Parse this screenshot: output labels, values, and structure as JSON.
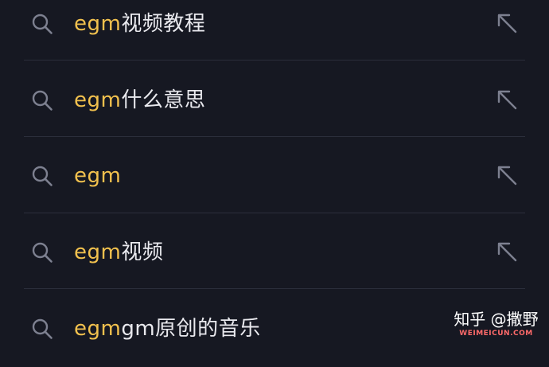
{
  "colors": {
    "background": "#161822",
    "highlight": "#f2c14e",
    "text": "#e9e9ee",
    "icon": "#7d8090",
    "divider": "#2b2e3b"
  },
  "suggestions": [
    {
      "match": "egm",
      "rest": "视频教程",
      "left_icon": "search-icon",
      "right_icon": "arrow-up-left-icon"
    },
    {
      "match": "egm",
      "rest": "什么意思",
      "left_icon": "search-icon",
      "right_icon": "arrow-up-left-icon"
    },
    {
      "match": "egm",
      "rest": "",
      "left_icon": "search-icon",
      "right_icon": "arrow-up-left-icon"
    },
    {
      "match": "egm",
      "rest": "视频",
      "left_icon": "search-icon",
      "right_icon": "arrow-up-left-icon"
    },
    {
      "match": "egm",
      "rest": "gm原创的音乐",
      "left_icon": "search-icon",
      "right_icon": ""
    }
  ],
  "watermark": {
    "main": "知乎 @撒野",
    "sub": "WEIMEICUN.COM"
  }
}
